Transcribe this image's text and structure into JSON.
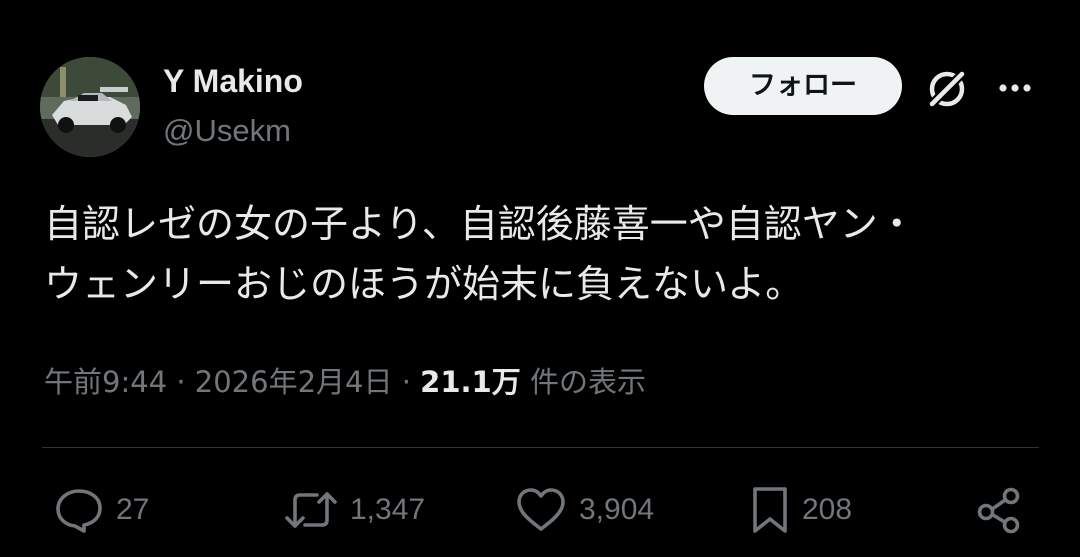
{
  "author": {
    "display_name": "Y Makino",
    "handle": "@Usekm"
  },
  "header": {
    "follow_label": "フォロー"
  },
  "tweet": {
    "text_lines": [
      "自認レゼの女の子より、自認後藤喜一や自認ヤン・",
      "ウェンリーおじのほうが始末に負えないよ。"
    ]
  },
  "meta": {
    "time": "午前9:44",
    "date": "2026年2月4日",
    "views_count": "21.1万",
    "views_label": "件の表示",
    "separator": "·"
  },
  "actions": {
    "replies": "27",
    "reposts": "1,347",
    "likes": "3,904",
    "bookmarks": "208"
  },
  "icons": {
    "avatar": "race-car-photo",
    "grok": "grok-icon",
    "more": "more-icon",
    "reply": "reply-icon",
    "repost": "repost-icon",
    "like": "like-icon",
    "bookmark": "bookmark-icon",
    "share": "share-icon"
  },
  "colors": {
    "background": "#000000",
    "text_primary": "#e7e9ea",
    "text_secondary": "#71767b",
    "divider": "#2f3336",
    "follow_button_bg": "#eff3f4"
  }
}
